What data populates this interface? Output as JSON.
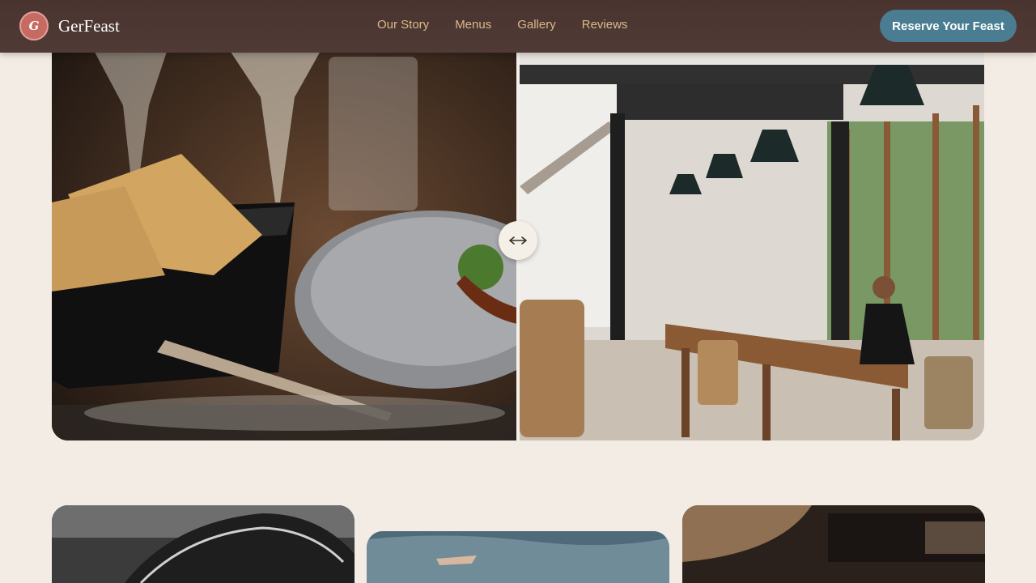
{
  "brand": {
    "initial": "G",
    "name": "GerFeast"
  },
  "nav": [
    "Our Story",
    "Menus",
    "Gallery",
    "Reviews"
  ],
  "cta_label": "Reserve Your Feast",
  "colors": {
    "header_bg": "#4d3733",
    "nav_text": "#d9b98a",
    "cta_bg": "#4a7d91",
    "page_bg": "#f2ece4",
    "brand_mark": "#c66a62"
  },
  "hero": {
    "left_image": "dining-table-bread-wine",
    "right_image": "restaurant-interior",
    "handle_icon": "compare-arrows-icon"
  },
  "gallery": [
    "grayscale-hands",
    "sky-landscape",
    "warm-food-closeup"
  ]
}
